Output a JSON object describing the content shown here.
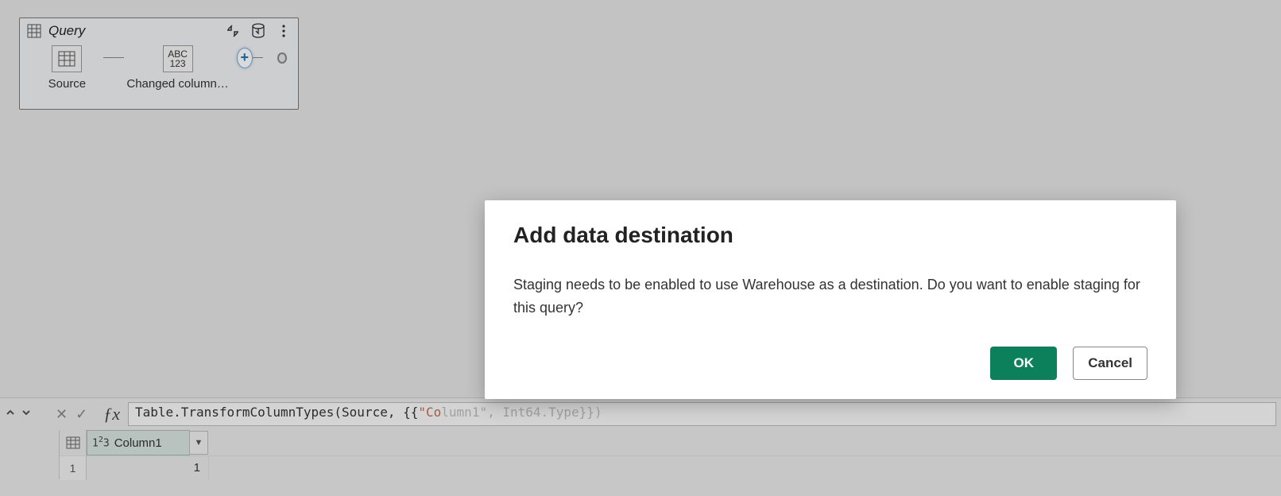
{
  "query_node": {
    "title": "Query",
    "steps": [
      {
        "label": "Source"
      },
      {
        "label": "Changed column…"
      }
    ],
    "step2_type_top": "ABC",
    "step2_type_bot": "123"
  },
  "formula_bar": {
    "text_plain": "Table.TransformColumnTypes(Source, {{\"Co",
    "text_prefix": "Table.TransformColumnTypes(Source, {{",
    "text_str_vis": "\"Co",
    "text_faded": "lumn1\", Int64.Type}})"
  },
  "grid": {
    "column_header": "Column1",
    "row_number": "1",
    "cell_value": "1"
  },
  "dialog": {
    "title": "Add data destination",
    "body": "Staging needs to be enabled to use Warehouse as a destination. Do you want to enable staging for this query?",
    "ok_label": "OK",
    "cancel_label": "Cancel"
  },
  "colors": {
    "primary": "#0c805b"
  }
}
